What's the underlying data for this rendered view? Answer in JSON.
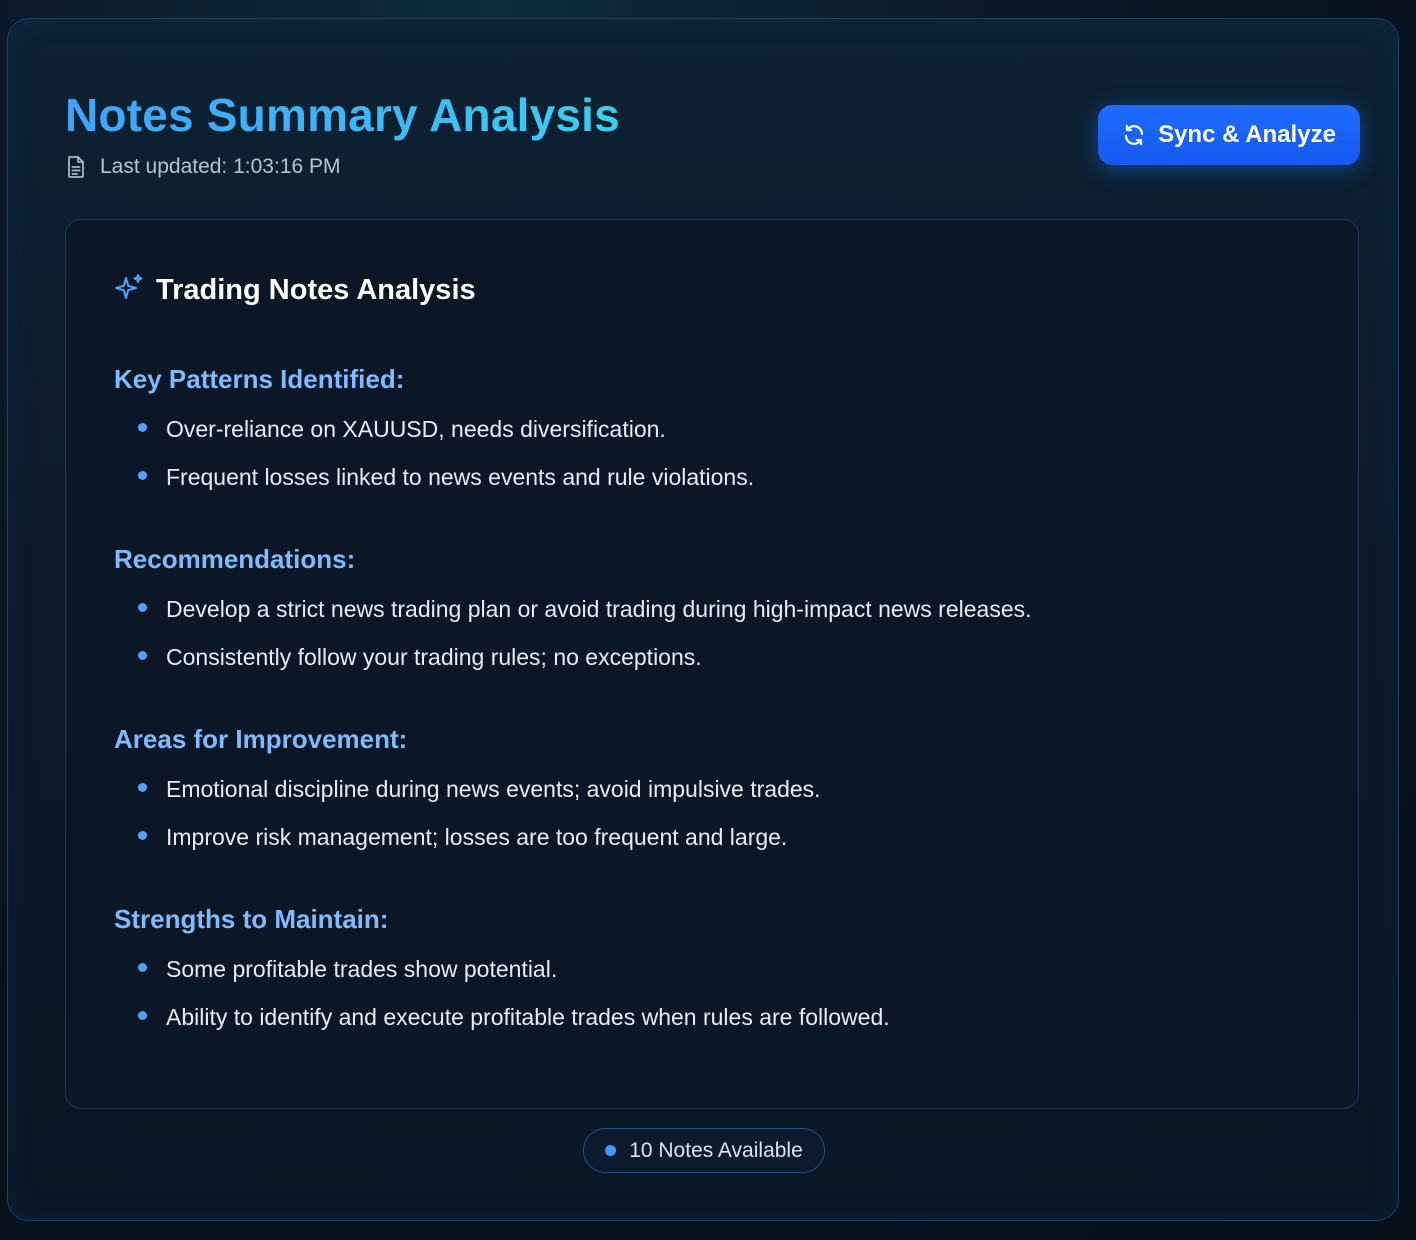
{
  "header": {
    "title": "Notes Summary Analysis",
    "last_updated": "Last updated: 1:03:16 PM",
    "sync_button_label": "Sync & Analyze"
  },
  "analysis": {
    "title": "Trading Notes Analysis",
    "sections": [
      {
        "title": "Key Patterns Identified:",
        "items": [
          "Over-reliance on XAUUSD, needs diversification.",
          "Frequent losses linked to news events and rule violations."
        ]
      },
      {
        "title": "Recommendations:",
        "items": [
          "Develop a strict news trading plan or avoid trading during high-impact news releases.",
          "Consistently follow your trading rules; no exceptions."
        ]
      },
      {
        "title": "Areas for Improvement:",
        "items": [
          "Emotional discipline during news events; avoid impulsive trades.",
          "Improve risk management; losses are too frequent and large."
        ]
      },
      {
        "title": "Strengths to Maintain:",
        "items": [
          "Some profitable trades show potential.",
          "Ability to identify and execute profitable trades when rules are followed."
        ]
      }
    ]
  },
  "footer": {
    "notes_count": "10 Notes Available"
  },
  "icons": {
    "document": "document-icon",
    "sync": "refresh-icon",
    "sparkle": "sparkles-icon"
  },
  "colors": {
    "accent": "#1f6cff",
    "title_gradient_start": "#3fa4ff",
    "title_gradient_end": "#3ad0ee",
    "section_title": "#7fbcff",
    "bullet": "#4fa3ff",
    "background": "#0b1627"
  }
}
